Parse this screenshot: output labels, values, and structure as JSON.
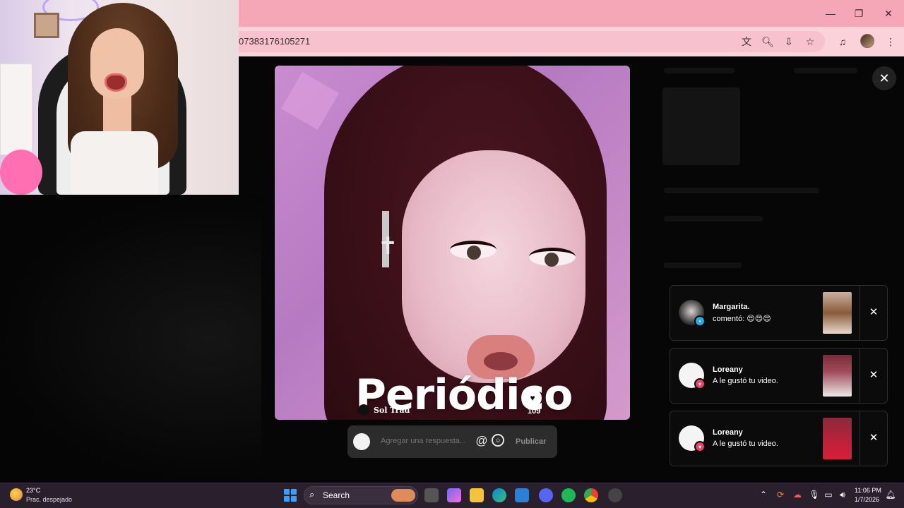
{
  "browser": {
    "url_fragment": "07383176105271"
  },
  "video": {
    "caption": "Periódico",
    "brand_logo": "Sol Trad",
    "like_count": "109"
  },
  "reply": {
    "placeholder": "Agregar una respuesta...",
    "mention_symbol": "@",
    "post_label": "Publicar"
  },
  "notifications": [
    {
      "name": "Margarita.",
      "text": "comentó: 😍😍😍",
      "badge": "comment",
      "badge_color": "#2aa8e0"
    },
    {
      "name": "Loreany",
      "text": "A le gustó tu video.",
      "badge": "heart",
      "badge_color": "#f03e6c"
    },
    {
      "name": "Loreany",
      "text": "A le gustó tu video.",
      "badge": "heart",
      "badge_color": "#f03e6c"
    }
  ],
  "taskbar": {
    "weather_temp": "23°C",
    "weather_desc": "Prac. despejado",
    "search_label": "Search",
    "time": "11:06 PM",
    "date": "1/7/2026"
  },
  "colors": {
    "titlebar": "#f5a7b8",
    "toolbar": "#fbd1da",
    "overlay_bg": "#060606"
  }
}
